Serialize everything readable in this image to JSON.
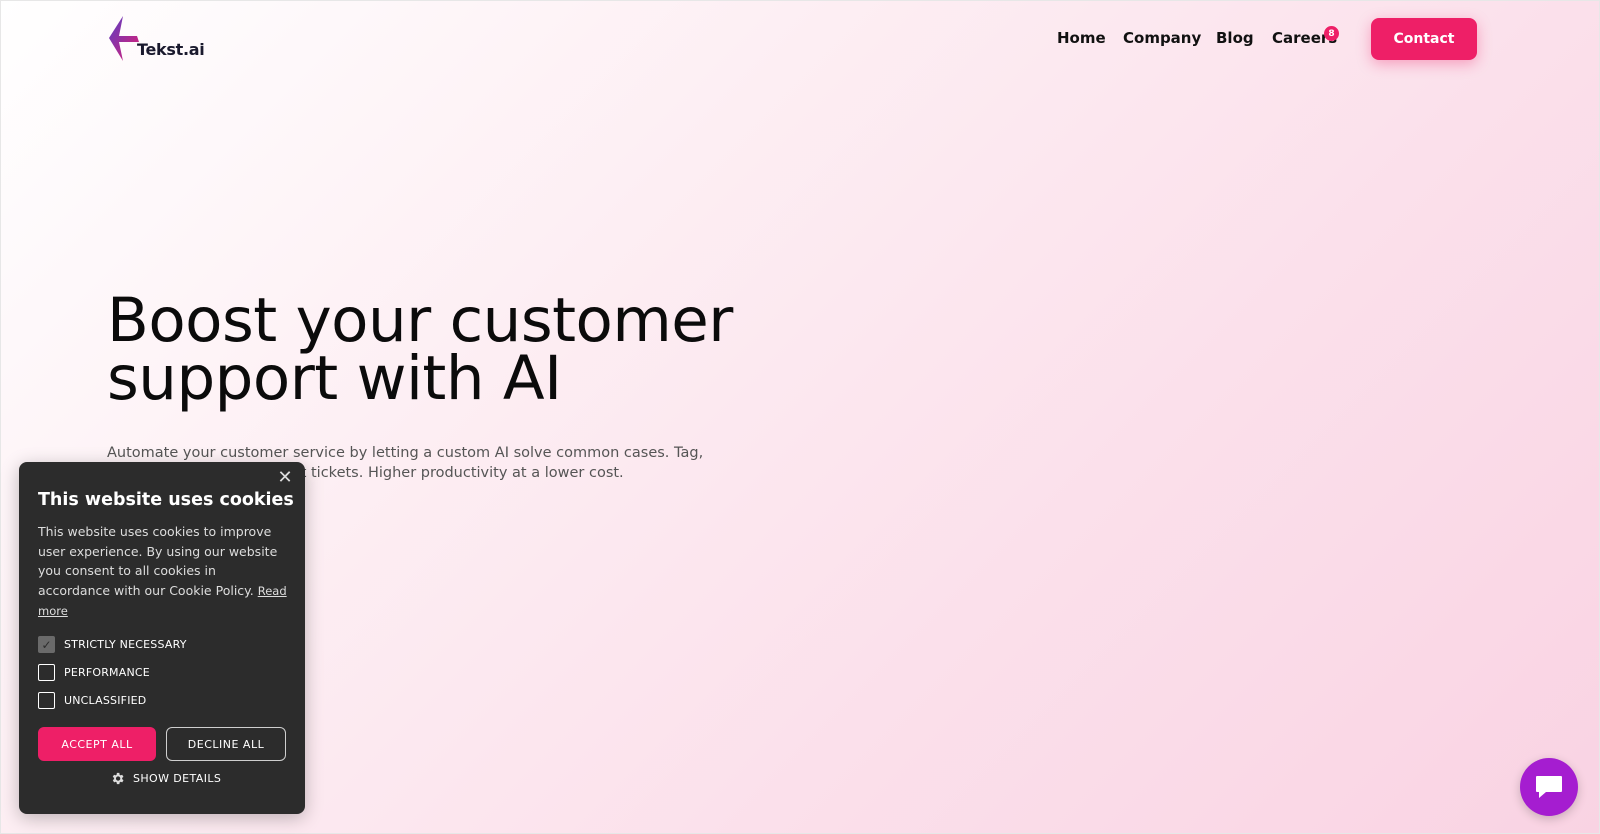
{
  "header": {
    "logo_text": "Tekst.ai",
    "nav": [
      {
        "label": "Home"
      },
      {
        "label": "Company"
      },
      {
        "label": "Blog"
      },
      {
        "label": "Careers"
      }
    ],
    "careers_badge": "8",
    "contact_label": "Contact"
  },
  "hero": {
    "title": "Boost your customer support with AI",
    "subtitle": "Automate your customer service by letting a custom AI solve common cases. Tag, prioritize and route support tickets. Higher productivity at a lower cost."
  },
  "cookie_banner": {
    "title": "This website uses cookies",
    "body": "This website uses cookies to improve user experience. By using our website you consent to all cookies in accordance with our Cookie Policy.",
    "read_more": "Read more",
    "options": [
      {
        "label": "STRICTLY NECESSARY",
        "checked": true
      },
      {
        "label": "PERFORMANCE",
        "checked": false
      },
      {
        "label": "UNCLASSIFIED",
        "checked": false
      }
    ],
    "accept_label": "ACCEPT ALL",
    "decline_label": "DECLINE ALL",
    "details_label": "SHOW DETAILS"
  },
  "colors": {
    "accent": "#ee1f67",
    "chat": "#a51dd0",
    "panel": "#2c2c2c"
  }
}
